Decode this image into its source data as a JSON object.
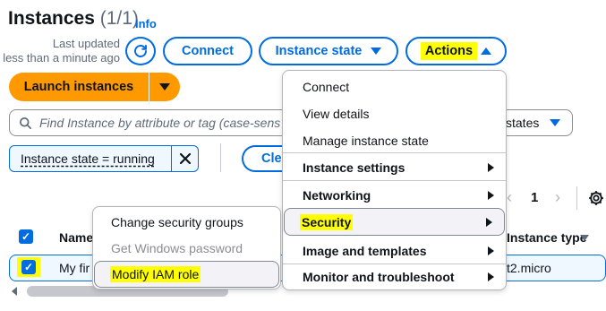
{
  "header": {
    "title": "Instances",
    "count": "(1/1)",
    "info_link": "Info",
    "last_updated_line1": "Last updated",
    "last_updated_line2": "less than a minute ago"
  },
  "toolbar": {
    "connect_label": "Connect",
    "instance_state_label": "Instance state",
    "actions_label": "Actions",
    "launch_label": "Launch instances"
  },
  "filter": {
    "search_placeholder": "Find Instance by attribute or tag (case-sens",
    "states_label": "states",
    "token_label": "Instance state = running",
    "clear_label": "Clea"
  },
  "pagination": {
    "current_page": "1"
  },
  "table": {
    "columns": [
      "Name",
      "Instance type"
    ],
    "rows": [
      {
        "name": "My fir",
        "instance_type": "t2.micro",
        "selected": true
      }
    ]
  },
  "actions_menu": {
    "items": [
      {
        "label": "Connect",
        "bold": false,
        "has_submenu": false
      },
      {
        "label": "View details",
        "bold": false,
        "has_submenu": false
      },
      {
        "label": "Manage instance state",
        "bold": false,
        "has_submenu": false
      },
      {
        "label": "Instance settings",
        "bold": true,
        "has_submenu": true
      },
      {
        "label": "Networking",
        "bold": true,
        "has_submenu": true
      },
      {
        "label": "Security",
        "bold": true,
        "has_submenu": true,
        "active": true
      },
      {
        "label": "Image and templates",
        "bold": true,
        "has_submenu": true
      },
      {
        "label": "Monitor and troubleshoot",
        "bold": true,
        "has_submenu": true
      }
    ]
  },
  "security_submenu": {
    "items": [
      {
        "label": "Change security groups",
        "disabled": false
      },
      {
        "label": "Get Windows password",
        "disabled": true
      },
      {
        "label": "Modify IAM role",
        "disabled": false,
        "hovered": true
      }
    ]
  },
  "colors": {
    "accent": "#006ce0",
    "primary_button": "#ff9900",
    "highlight": "#ffff00"
  },
  "icons": [
    "refresh-icon",
    "search-icon",
    "close-icon",
    "settings-gear-icon",
    "chevron-left-icon",
    "chevron-right-icon",
    "checkbox-checked-icon"
  ]
}
